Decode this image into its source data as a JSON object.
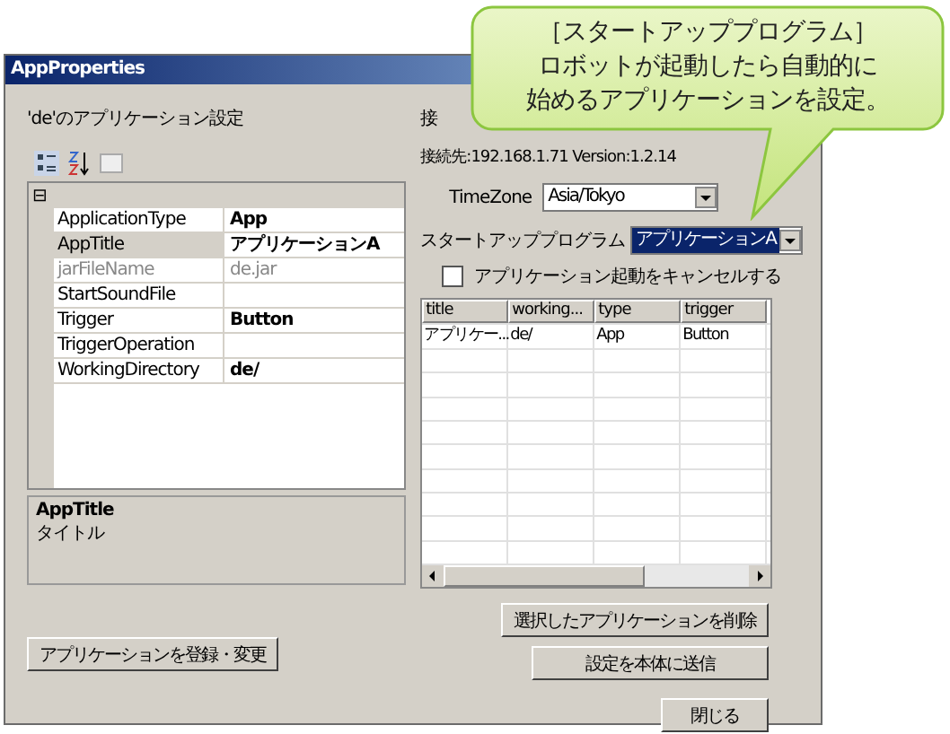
{
  "window": {
    "title": "AppProperties"
  },
  "settings": {
    "heading": "'de'のアプリケーション設定",
    "property_grid": {
      "collapse_glyph": "⊟",
      "rows": [
        {
          "name": "ApplicationType",
          "value": "App",
          "selected": false,
          "disabled": false
        },
        {
          "name": "AppTitle",
          "value": "アプリケーションA",
          "selected": true,
          "disabled": false
        },
        {
          "name": "jarFileName",
          "value": "de.jar",
          "selected": false,
          "disabled": true
        },
        {
          "name": "StartSoundFile",
          "value": "",
          "selected": false,
          "disabled": false
        },
        {
          "name": "Trigger",
          "value": "Button",
          "selected": false,
          "disabled": false
        },
        {
          "name": "TriggerOperation",
          "value": "",
          "selected": false,
          "disabled": false
        },
        {
          "name": "WorkingDirectory",
          "value": "de/",
          "selected": false,
          "disabled": false
        }
      ]
    },
    "description": {
      "title": "AppTitle",
      "text": "タイトル"
    },
    "register_button": "アプリケーションを登録・変更"
  },
  "robot": {
    "partial_label": "接",
    "connection": "接続先:192.168.1.71   Version:1.2.14",
    "timezone": {
      "label": "TimeZone",
      "value": "Asia/Tokyo"
    },
    "startup": {
      "label": "スタートアッププログラム",
      "value": "アプリケーションA"
    },
    "cancel_checkbox": {
      "label": "アプリケーション起動をキャンセルする",
      "checked": false
    },
    "table": {
      "columns": [
        "title",
        "working...",
        "type",
        "trigger"
      ],
      "rows": [
        [
          "アプリケー...",
          "de/",
          "App",
          "Button"
        ]
      ]
    },
    "buttons": [
      "選択したアプリケーションを削除",
      "設定を本体に送信"
    ],
    "close_button": "閉じる"
  },
  "callout": {
    "lines": [
      "［スタートアッププログラム］",
      "ロボットが起動したら自動的に",
      "始めるアプリケーションを設定。"
    ]
  }
}
